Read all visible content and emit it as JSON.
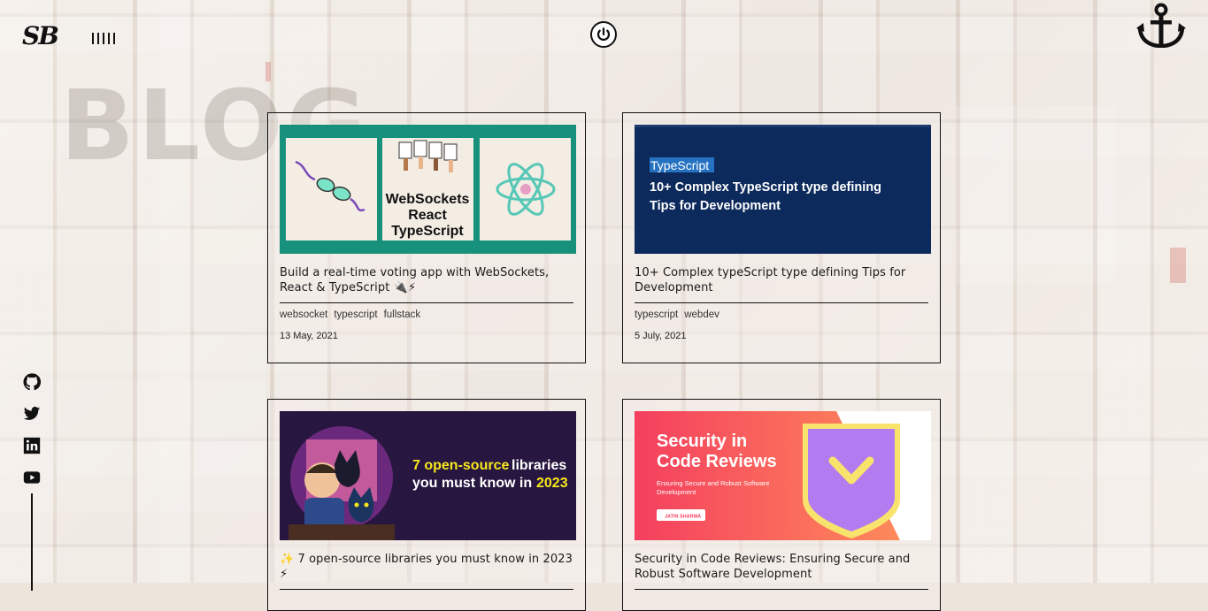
{
  "header": {
    "logo": "SB",
    "watermark": "BLOG"
  },
  "icons": {
    "menu": "menu-bars-icon",
    "power": "power-icon",
    "anchor": "anchor-icon",
    "github": "github-icon",
    "twitter": "twitter-icon",
    "linkedin": "linkedin-icon",
    "youtube": "youtube-icon"
  },
  "posts": [
    {
      "title": "Build a real-time voting app with WebSockets, React & TypeScript 🔌⚡",
      "tags": [
        "websocket",
        "typescript",
        "fullstack"
      ],
      "date": "13 May, 2021",
      "thumb": {
        "text1": "WebSockets",
        "text2": "React",
        "text3": "TypeScript"
      }
    },
    {
      "title": "10+ Complex typeScript type defining Tips for Development",
      "tags": [
        "typescript",
        "webdev"
      ],
      "date": "5 July, 2021",
      "thumb": {
        "label": "TypeScript",
        "line1": "10+ Complex TypeScript type defining",
        "line2": "Tips for Development"
      }
    },
    {
      "title": "✨ 7 open-source libraries you must know in 2023 ⚡",
      "thumb": {
        "line1a": "7 open-source",
        "line1b": " libraries",
        "line2": "you must know in ",
        "year": "2023"
      }
    },
    {
      "title": "Security in Code Reviews: Ensuring Secure and Robust Software Development",
      "thumb": {
        "line1": "Security in",
        "line2": "Code Reviews",
        "sub1": "Ensuring Secure and Robust Software",
        "sub2": "Development",
        "author": "JATIN SHARMA"
      }
    }
  ],
  "colors": {
    "teal": "#17907c",
    "navy": "#0d2a5c",
    "purple": "#271640",
    "yellow": "#f8e71c",
    "red_gradient_start": "#f43f5e",
    "red_gradient_end": "#ff8a5b"
  }
}
